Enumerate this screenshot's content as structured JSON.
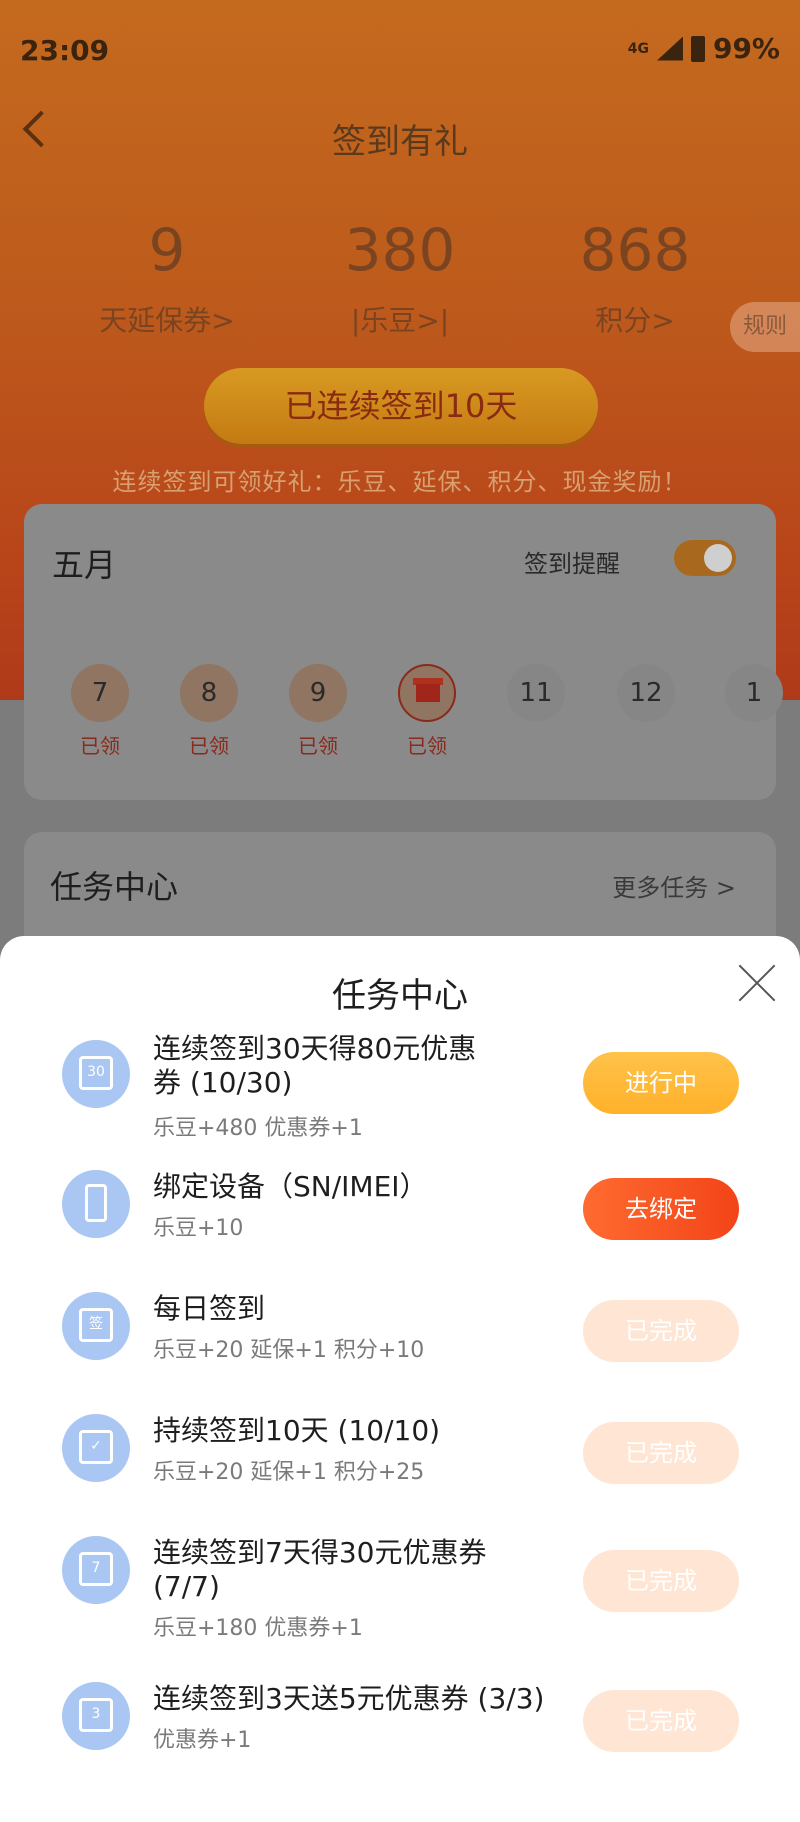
{
  "status_bar": {
    "time": "23:09",
    "network": "4G",
    "battery": "99%"
  },
  "nav": {
    "title": "签到有礼"
  },
  "stats": [
    {
      "value": "9",
      "label": "天延保券>"
    },
    {
      "value": "380",
      "label": "|乐豆>|"
    },
    {
      "value": "868",
      "label": "积分>"
    }
  ],
  "rules_label": "规则",
  "signed_button": "已连续签到10天",
  "tip": "连续签到可领好礼：乐豆、延保、积分、现金奖励！",
  "calendar": {
    "month": "五月",
    "remind_label": "签到提醒",
    "days": [
      {
        "day": "7",
        "label": "已领"
      },
      {
        "day": "8",
        "label": "已领"
      },
      {
        "day": "9",
        "label": "已领"
      },
      {
        "day": "",
        "label": "已领"
      },
      {
        "day": "11",
        "label": ""
      },
      {
        "day": "12",
        "label": ""
      },
      {
        "day": "1",
        "label": ""
      }
    ]
  },
  "task_card": {
    "title": "任务中心",
    "more": "更多任务 >"
  },
  "sheet": {
    "title": "任务中心",
    "tasks": [
      {
        "name": "连续签到30天得80元优惠券 (10/30)",
        "reward": "乐豆+480 优惠券+1",
        "icon_text": "30",
        "button": "进行中"
      },
      {
        "name": "绑定设备（SN/IMEI）",
        "reward": "乐豆+10",
        "icon_text": "",
        "button": "去绑定"
      },
      {
        "name": "每日签到",
        "reward": "乐豆+20 延保+1 积分+10",
        "icon_text": "签",
        "button": "已完成"
      },
      {
        "name": "持续签到10天 (10/10)",
        "reward": "乐豆+20 延保+1 积分+25",
        "icon_text": "✓",
        "button": "已完成"
      },
      {
        "name": "连续签到7天得30元优惠券 (7/7)",
        "reward": "乐豆+180 优惠券+1",
        "icon_text": "7",
        "button": "已完成"
      },
      {
        "name": "连续签到3天送5元优惠券 (3/3)",
        "reward": "优惠券+1",
        "icon_text": "3",
        "button": "已完成"
      }
    ]
  }
}
